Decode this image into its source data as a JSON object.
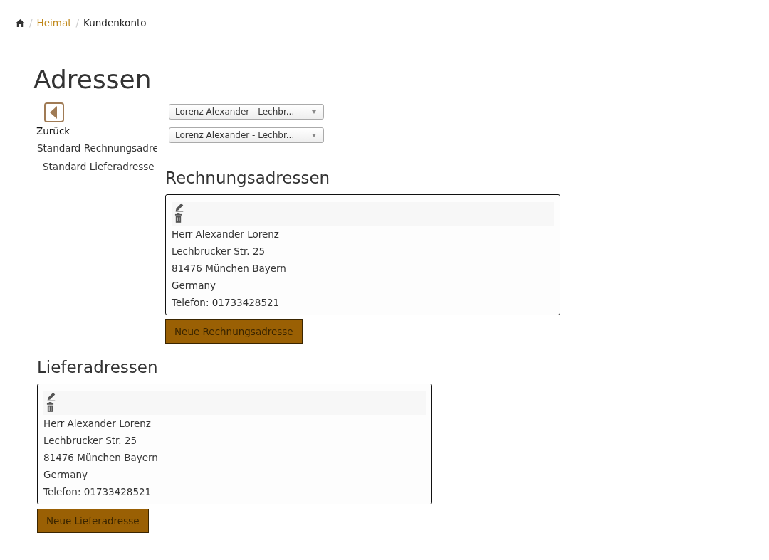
{
  "breadcrumb": [
    {
      "label": "Heimat",
      "kind": "link",
      "separator": "/"
    },
    {
      "label": "Kundenkonto",
      "kind": "current",
      "separator": "/"
    }
  ],
  "title": "Adressen",
  "sidebar": {
    "back_label": "Zurück",
    "items": [
      "Standard Rechnungsadre",
      "Standard Lieferadresse"
    ]
  },
  "selects": [
    {
      "value": "Lorenz Alexander - Lechbr..."
    },
    {
      "value": "Lorenz Alexander - Lechbr..."
    }
  ],
  "billing": {
    "heading": "Rechnungsadressen",
    "addresses": [
      {
        "lines": [
          "Herr Alexander Lorenz",
          "Lechbrucker Str. 25",
          "81476 München Bayern",
          "Germany",
          "Telefon: 01733428521"
        ]
      }
    ],
    "button": "Neue Rechnungsadresse"
  },
  "shipping": {
    "heading": "Lieferadressen",
    "addresses": [
      {
        "lines": [
          "Herr Alexander Lorenz",
          "Lechbrucker Str. 25",
          "81476 München Bayern",
          "Germany",
          "Telefon: 01733428521"
        ]
      }
    ],
    "button": "Neue Lieferadresse"
  }
}
